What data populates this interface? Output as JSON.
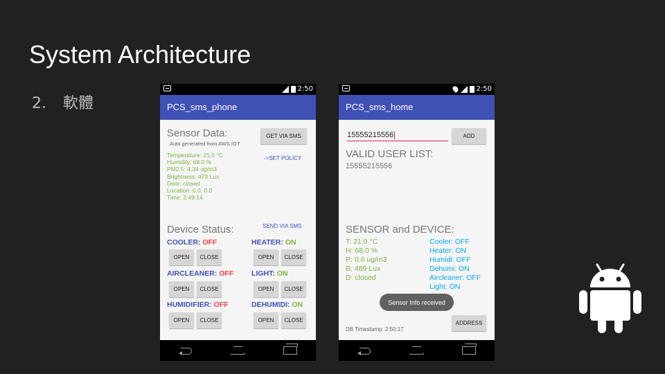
{
  "slide": {
    "title": "System Architecture",
    "item_number": "2.",
    "item_text": "軟體"
  },
  "phone1": {
    "time": "2:50",
    "app_title": "PCS_sms_phone",
    "sensor_heading": "Sensor Data:",
    "sensor_sub": "Auto generated from AWS IOT",
    "get_button": "GET  VIA  SMS",
    "set_policy": "->SET POLICY",
    "sensor_lines": [
      "Temperature:  21.0 °C",
      "Humidity:  68.0 %",
      "PM2.5:  4.34 ug/m3",
      "Brightness:  473 Lux",
      "Door:  closed",
      "Location:  0.0, 0.0",
      "Time: 2:49:14"
    ],
    "device_heading": "Device Status:",
    "send_sms": "SEND VIA SMS",
    "open_label": "OPEN",
    "close_label": "CLOSE",
    "devices": [
      {
        "name": "COOLER:",
        "state": "OFF"
      },
      {
        "name": "HEATER:",
        "state": "ON"
      },
      {
        "name": "AIRCLEANER:",
        "state": "OFF"
      },
      {
        "name": "LIGHT:",
        "state": "ON"
      },
      {
        "name": "HUMIDIFIER:",
        "state": "OFF"
      },
      {
        "name": "DEHUMIDI:",
        "state": "ON"
      }
    ]
  },
  "phone2": {
    "time": "2:50",
    "app_title": "PCS_sms_home",
    "phone_input_value": "15555215556",
    "add_button": "ADD",
    "valid_heading": "VALID USER LIST:",
    "valid_user": "15555215556",
    "sensor_device_heading": "SENSOR and DEVICE:",
    "sensor_lines": [
      "T:  21.0 °C",
      "H:  68.0 %",
      "P:  0.0 ug/m3",
      "B:  489 Lux",
      "D:  closed"
    ],
    "device_lines": [
      "Cooler:  OFF",
      "Heater:  ON",
      "Humidi:  OFF",
      "Dehumi:  ON",
      "Aircleaner:  OFF",
      "Light:  ON"
    ],
    "toast": "Sensor Info received",
    "address_button": "ADDRESS",
    "db_timestamp": "DB Timestamp: 2:50:17"
  },
  "colors": {
    "background": "#212121",
    "app_bar": "#3f51b5",
    "sensor_green": "#7cb342",
    "off_red": "#ff3d3d",
    "device_cyan": "#03a9f4"
  },
  "icons": [
    "message-notification-icon",
    "signal-icon",
    "battery-icon",
    "location-icon",
    "back-nav-icon",
    "home-nav-icon",
    "recent-apps-icon",
    "android-logo-icon"
  ]
}
